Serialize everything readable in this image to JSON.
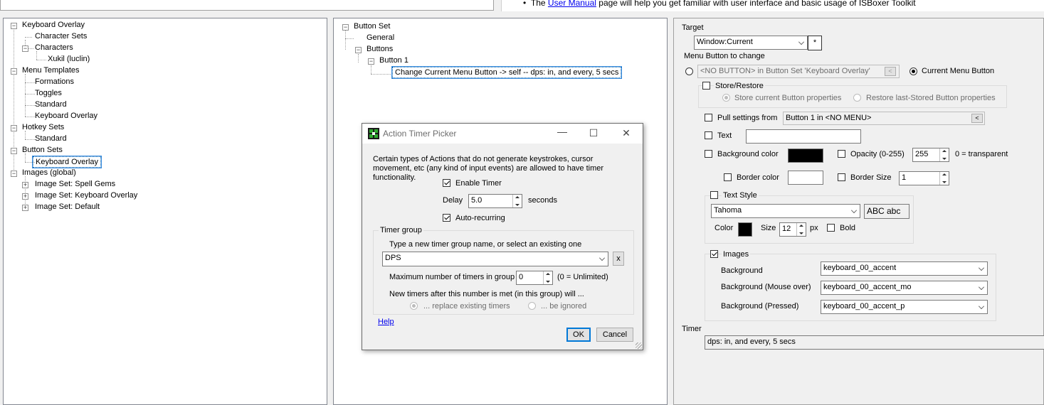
{
  "top": {
    "doc_prefix": "The",
    "doc_link": "User Manual",
    "doc_suffix": "page will help you get familiar with user interface and basic usage of ISBoxer Toolkit"
  },
  "left_tree": {
    "items": [
      {
        "label": "Keyboard Overlay"
      },
      {
        "label": "Character Sets"
      },
      {
        "label": "Characters"
      },
      {
        "label": "Xukil (luclin)"
      },
      {
        "label": "Menu Templates"
      },
      {
        "label": "Formations"
      },
      {
        "label": "Toggles"
      },
      {
        "label": "Standard"
      },
      {
        "label": "Keyboard Overlay"
      },
      {
        "label": "Hotkey Sets"
      },
      {
        "label": "Standard"
      },
      {
        "label": "Button Sets"
      },
      {
        "label": "Keyboard Overlay"
      },
      {
        "label": "Images (global)"
      },
      {
        "label": "Image Set: Spell Gems"
      },
      {
        "label": "Image Set: Keyboard Overlay"
      },
      {
        "label": "Image Set: Default"
      }
    ]
  },
  "mid_tree": {
    "items": [
      {
        "label": "Button Set"
      },
      {
        "label": "General"
      },
      {
        "label": "Buttons"
      },
      {
        "label": "Button 1"
      },
      {
        "label": "Change Current Menu Button -> self -- dps: in, and every, 5 secs"
      }
    ]
  },
  "props": {
    "target_label": "Target",
    "target_value": "Window:Current",
    "target_btn": "*",
    "menu_button_label": "Menu Button to change",
    "no_button_value": "<NO BUTTON> in Button Set 'Keyboard Overlay'",
    "no_button_btn": "<",
    "current_menu_button": "Current Menu Button",
    "store_restore": "Store/Restore",
    "store_current": "Store current Button properties",
    "restore_last": "Restore last-Stored Button properties",
    "pull_settings": "Pull settings from",
    "pull_value": "Button 1 in <NO MENU>",
    "pull_btn": "<",
    "text_label": "Text",
    "text_value": "",
    "bg_color": "Background color",
    "opacity": "Opacity (0-255)",
    "opacity_value": "255",
    "transparent_note": "0 = transparent",
    "border_color": "Border color",
    "border_size": "Border Size",
    "border_size_value": "1",
    "text_style": "Text Style",
    "font_value": "Tahoma",
    "font_preview": "ABC abc",
    "color_label": "Color",
    "size_label": "Size",
    "size_value": "12",
    "px_label": "px",
    "bold_label": "Bold",
    "images_label": "Images",
    "img_bg_label": "Background",
    "img_bg_value": "keyboard_00_accent",
    "img_bg_mo_label": "Background (Mouse over)",
    "img_bg_mo_value": "keyboard_00_accent_mo",
    "img_bg_p_label": "Background (Pressed)",
    "img_bg_p_value": "keyboard_00_accent_p",
    "timer_label": "Timer",
    "timer_value": "dps: in, and every, 5 secs"
  },
  "dialog": {
    "title": "Action Timer Picker",
    "minimize": "—",
    "maximize": "☐",
    "close": "✕",
    "description": "Certain types of Actions that do not generate keystrokes, cursor movement, etc (any kind of input events) are allowed to have timer functionality.",
    "enable_timer": "Enable Timer",
    "delay_label": "Delay",
    "delay_value": "5.0",
    "seconds_label": "seconds",
    "auto_recurring": "Auto-recurring",
    "timer_group": "Timer group",
    "group_hint": "Type a new timer group name, or select an existing one",
    "group_value": "DPS",
    "clear_btn": "x",
    "max_timers_label": "Maximum number of timers in group",
    "max_timers_value": "0",
    "unlimited_note": "(0 = Unlimited)",
    "new_timers_note": "New timers after this number is met (in this group) will ...",
    "replace_opt": "... replace existing timers",
    "ignore_opt": "... be ignored",
    "help": "Help",
    "ok": "OK",
    "cancel": "Cancel"
  },
  "colors": {
    "bg_color": "#000000",
    "border_color": "#ffffff",
    "text_color": "#000000"
  }
}
